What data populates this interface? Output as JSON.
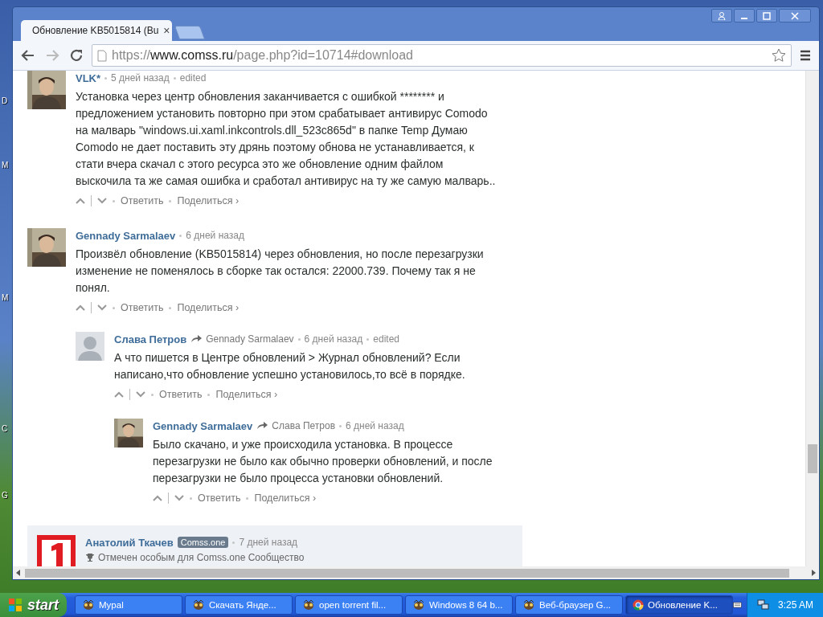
{
  "desktop_labels": [
    "D",
    "M",
    "M",
    "C",
    "G"
  ],
  "browser": {
    "tab": {
      "title": "Обновление KB5015814 (Bu",
      "close": "×"
    },
    "url": {
      "scheme": "https://",
      "host": "www.comss.ru",
      "path": "/page.php?id=10714#download"
    }
  },
  "comments": [
    {
      "author": "VLK*",
      "time": "5 дней назад",
      "edited": "edited",
      "text": "Установка через центр обновления заканчивается с ошибкой ******** и предложением установить повторно при этом срабатывает антивирус Comodo на малварь \"windows.ui.xaml.inkcontrols.dll_523c865d\" в папке Temp Думаю Comodo не дает поставить эту дрянь поэтому обнова не устанавливается, к стати вчера скачал с этого ресурса это же обновление одним файлом выскочила та же самая ошибка и сработал антивирус на ту же самую малварь..",
      "reply": "Ответить",
      "share": "Поделиться ›"
    },
    {
      "author": "Gennady Sarmalaev",
      "time": "6 дней назад",
      "text": "Произвёл обновление (KB5015814) через обновления, но после перезагрузки изменение не поменялось в сборке так остался: 22000.739. Почему так я не понял.",
      "reply": "Ответить",
      "share": "Поделиться ›",
      "children": [
        {
          "kind": "default",
          "author": "Слава Петров",
          "reply_to": "Gennady Sarmalaev",
          "time": "6 дней назад",
          "edited": "edited",
          "text": "А что пишется в Центре обновлений > Журнал обновлений? Если написано,что обновление успешно установилось,то всё в порядке.",
          "reply": "Ответить",
          "share": "Поделиться ›",
          "children": [
            {
              "author": "Gennady Sarmalaev",
              "reply_to": "Слава Петров",
              "time": "6 дней назад",
              "text": "Было скачано, и уже происходила установка. В процессе перезагрузки не было как обычно проверки обновлений, и после перезагрузки не было процесса установки обновлений.",
              "reply": "Ответить",
              "share": "Поделиться ›"
            }
          ]
        }
      ]
    },
    {
      "kind": "logo",
      "author": "Анатолий Ткачев",
      "badge": "Comss.one",
      "time": "7 дней назад",
      "highlighted": true,
      "note": "Отмечен особым для Comss.one Сообщество"
    }
  ],
  "taskbar": {
    "start": "start",
    "tasks": [
      {
        "label": "Mypal",
        "kind": "browser",
        "selected": false
      },
      {
        "label": "Скачать Янде...",
        "kind": "browser",
        "selected": false
      },
      {
        "label": "open torrent fil...",
        "kind": "browser",
        "selected": false
      },
      {
        "label": "Windows 8 64 b...",
        "kind": "browser",
        "selected": false
      },
      {
        "label": "Веб-браузер G...",
        "kind": "browser",
        "selected": false
      },
      {
        "label": "Обновление K...",
        "kind": "chrome",
        "selected": true
      }
    ],
    "clock": "3:25 AM"
  }
}
